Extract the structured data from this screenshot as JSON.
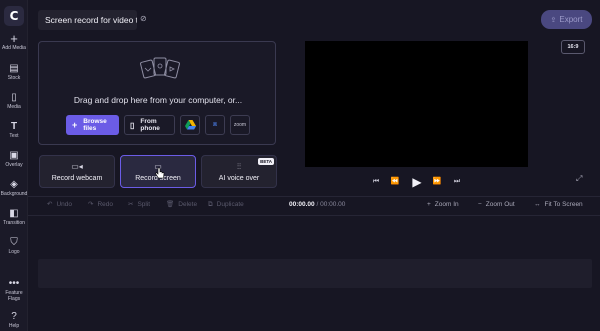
{
  "app": {
    "logo_letter": "C",
    "project_title": "Screen record for video tu",
    "export_label": "Export",
    "accent_color": "#6b5ce6"
  },
  "sidebar": {
    "items": [
      {
        "label": "Add Media",
        "icon": "plus-icon"
      },
      {
        "label": "Stock",
        "icon": "stock-icon"
      },
      {
        "label": "Media",
        "icon": "file-icon"
      },
      {
        "label": "Text",
        "icon": "text-icon"
      },
      {
        "label": "Overlay",
        "icon": "overlay-icon"
      },
      {
        "label": "Background",
        "icon": "layers-icon"
      },
      {
        "label": "Transition",
        "icon": "transition-icon"
      },
      {
        "label": "Logo",
        "icon": "shield-icon"
      },
      {
        "label": "Feature Flags",
        "icon": "more-icon"
      },
      {
        "label": "Help",
        "icon": "help-icon"
      }
    ]
  },
  "upload": {
    "drop_text": "Drag and drop here from your computer, or...",
    "browse_label": "Browse files",
    "phone_label": "From phone",
    "sources": [
      "google-drive-icon",
      "dropbox-icon",
      "zoom"
    ],
    "zoom_label": "zoom",
    "dropbox_label": "⧈"
  },
  "record": {
    "webcam_label": "Record webcam",
    "screen_label": "Record screen",
    "voice_label": "AI voice over",
    "beta_label": "BETA"
  },
  "preview": {
    "aspect_ratio": "16:9"
  },
  "toolbar": {
    "undo": "Undo",
    "redo": "Redo",
    "split": "Split",
    "delete": "Delete",
    "duplicate": "Duplicate",
    "time_current": "00:00.00",
    "time_sep": " / ",
    "time_total": "00:00.00",
    "zoom_in": "Zoom In",
    "zoom_out": "Zoom Out",
    "fit": "Fit To Screen"
  }
}
